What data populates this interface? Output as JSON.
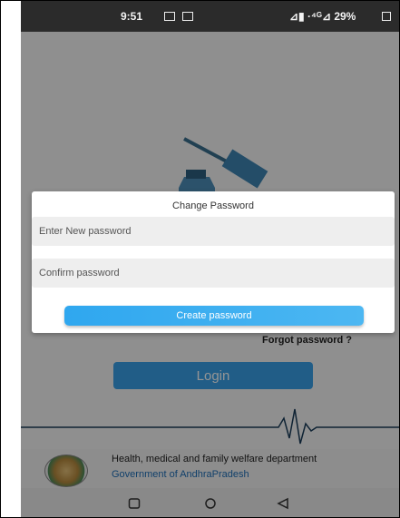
{
  "status_bar": {
    "time": "9:51",
    "right_text": "⊿▮ ·⁴ᴳ⊿ 29%"
  },
  "app": {
    "forgot_password": "Forgot password ?",
    "login_label": "Login",
    "footer": {
      "department": "Health, medical and family welfare department",
      "government": "Government of AndhraPradesh"
    }
  },
  "dialog": {
    "title": "Change Password",
    "new_password_placeholder": "Enter New password",
    "confirm_password_placeholder": "Confirm password",
    "create_button": "Create password"
  },
  "icons": {
    "app_logo": "syringe-vial-icon",
    "emblem": "government-emblem-icon",
    "nav_recents": "square-icon",
    "nav_home": "circle-icon",
    "nav_back": "triangle-back-icon"
  },
  "colors": {
    "accent": "#3aa0e8",
    "link": "#1e6fb8",
    "overlay": "rgba(0,0,0,0.42)"
  }
}
